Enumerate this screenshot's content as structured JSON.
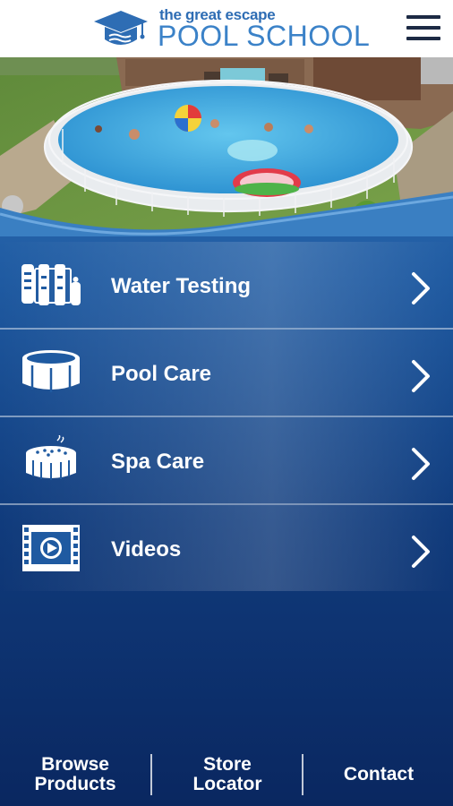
{
  "header": {
    "tagline": "the great escape",
    "title": "POOL SCHOOL",
    "logo_icon": "graduation-cap-icon",
    "menu_icon": "hamburger-menu-icon"
  },
  "hero": {
    "image": "aerial-photo-backyard-above-ground-pool"
  },
  "menu": {
    "items": [
      {
        "label": "Water Testing",
        "icon": "test-kit-icon"
      },
      {
        "label": "Pool Care",
        "icon": "pool-icon"
      },
      {
        "label": "Spa Care",
        "icon": "hot-tub-icon"
      },
      {
        "label": "Videos",
        "icon": "video-play-icon"
      }
    ],
    "chevron_icon": "chevron-right-icon"
  },
  "footer": {
    "browse": "Browse Products",
    "store": "Store Locator",
    "contact": "Contact"
  },
  "colors": {
    "brand_blue": "#3b82c8",
    "background_top": "#2f73b8",
    "background_bottom": "#0b2a62",
    "text": "#ffffff"
  }
}
